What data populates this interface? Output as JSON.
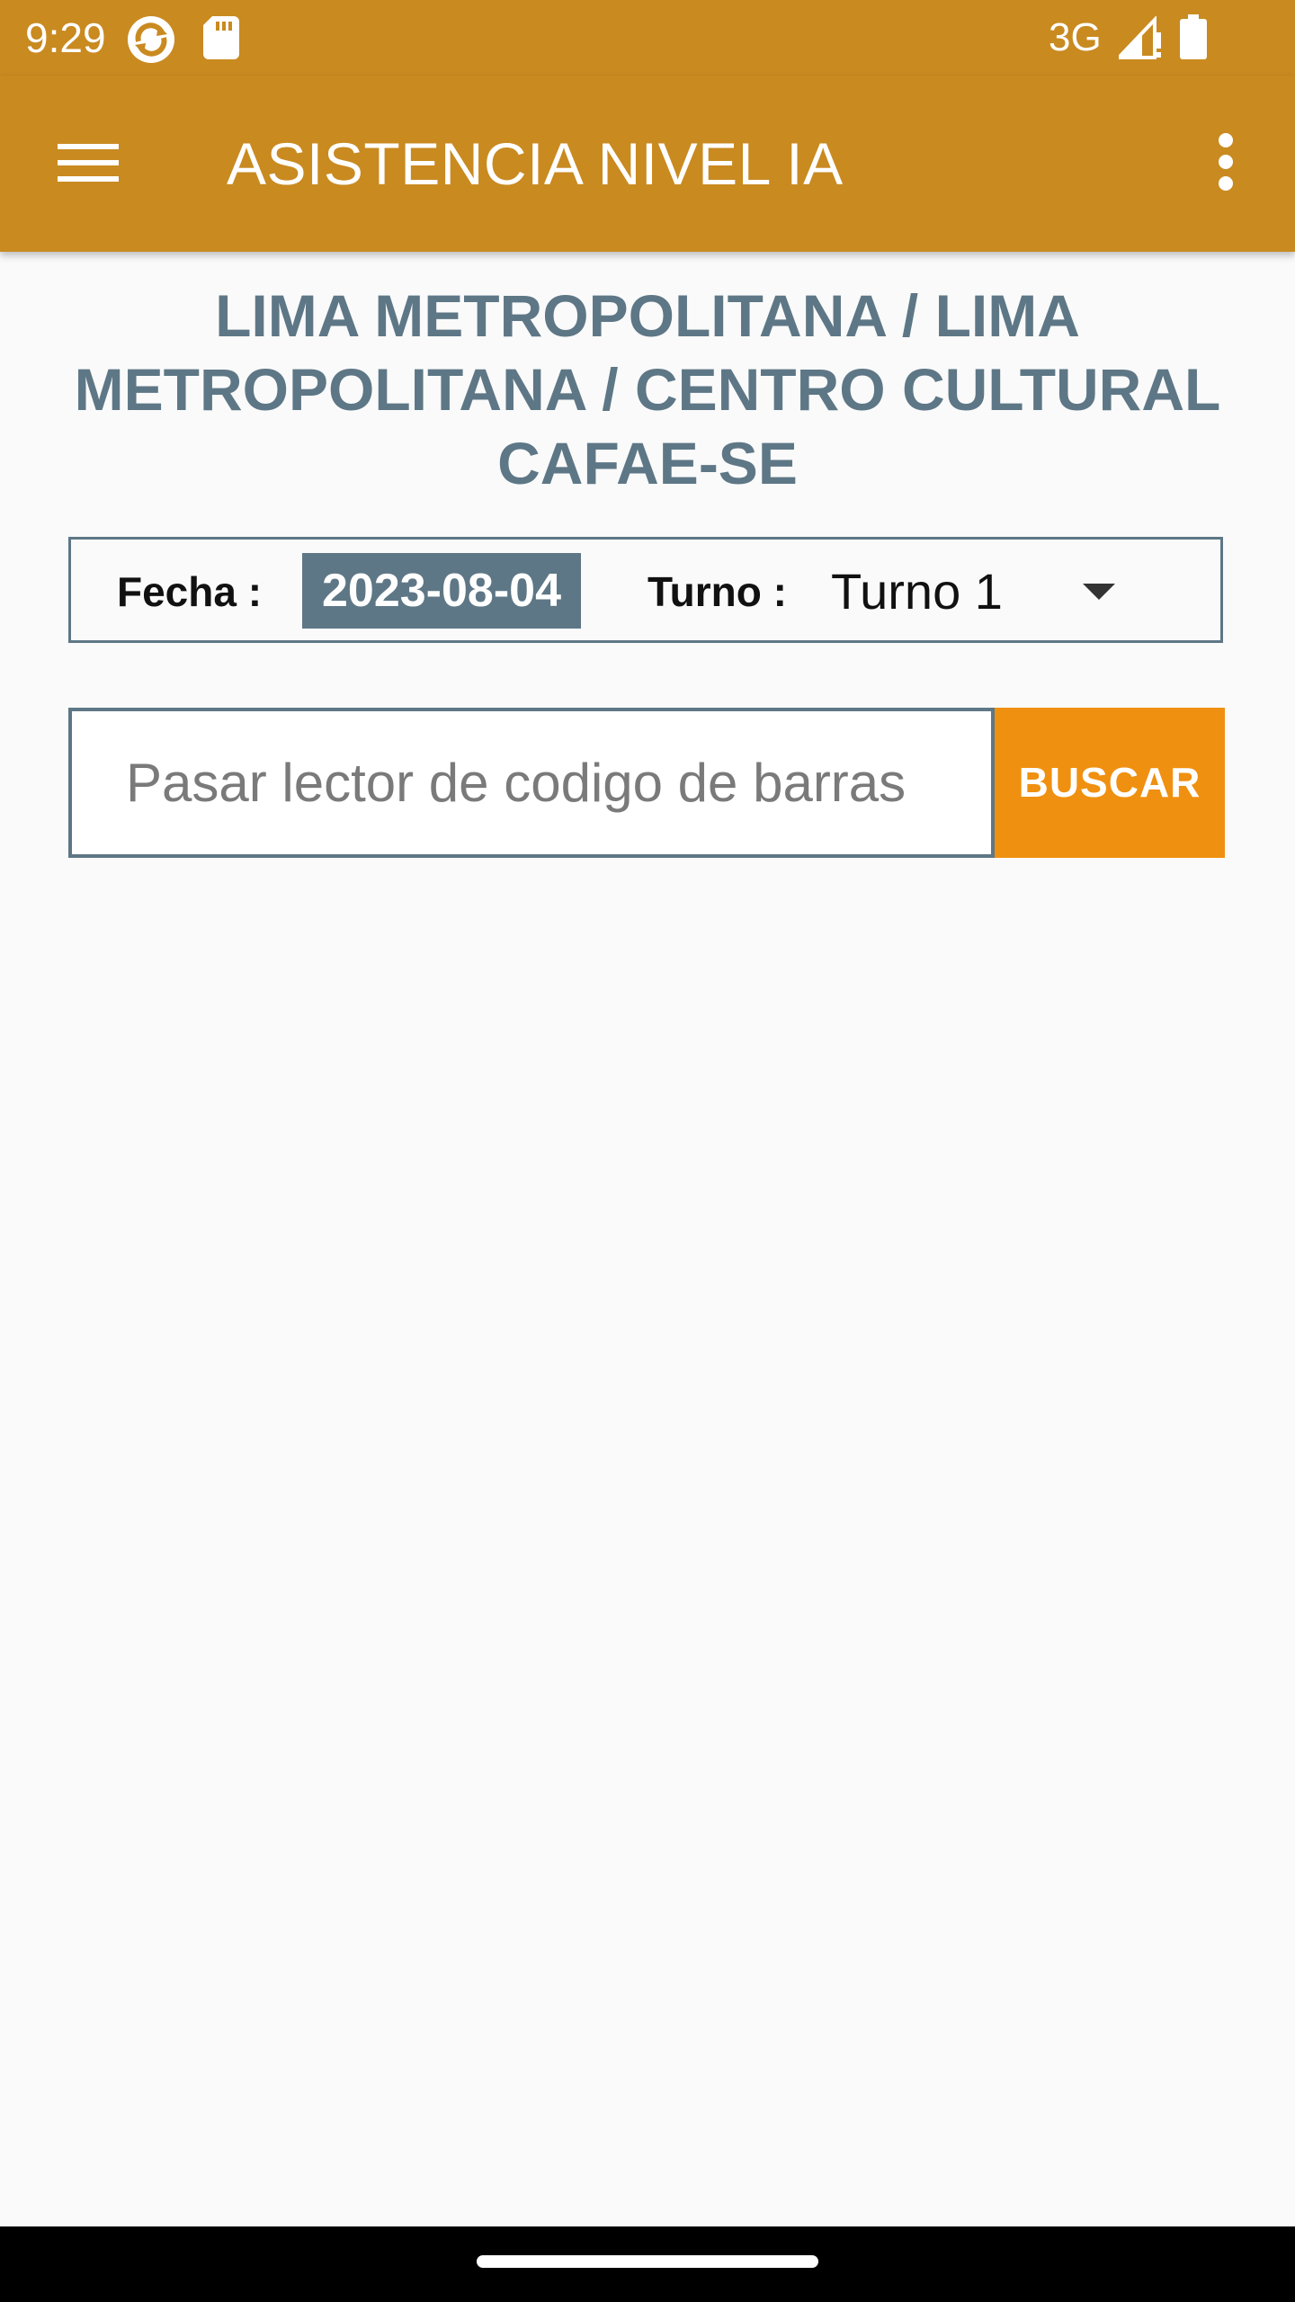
{
  "status_bar": {
    "time": "9:29",
    "network": "3G",
    "icons": [
      "sync-app-icon",
      "sd-card-icon",
      "signal-icon",
      "battery-icon"
    ]
  },
  "app_bar": {
    "title": "ASISTENCIA NIVEL IA",
    "color": "#c98a20",
    "icons": [
      "hamburger-menu-icon",
      "more-vert-icon"
    ]
  },
  "main": {
    "location": "LIMA METROPOLITANA / LIMA METROPOLITANA / CENTRO CULTURAL CAFAE-SE",
    "location_color": "#5e7786",
    "filters": {
      "fecha_label": "Fecha :",
      "fecha_value": "2023-08-04",
      "turno_label": "Turno :",
      "turno_selected": "Turno 1"
    },
    "search": {
      "placeholder": "Pasar lector de codigo de barras",
      "value": "",
      "button_label": "BUSCAR",
      "button_color": "#f09010"
    }
  }
}
